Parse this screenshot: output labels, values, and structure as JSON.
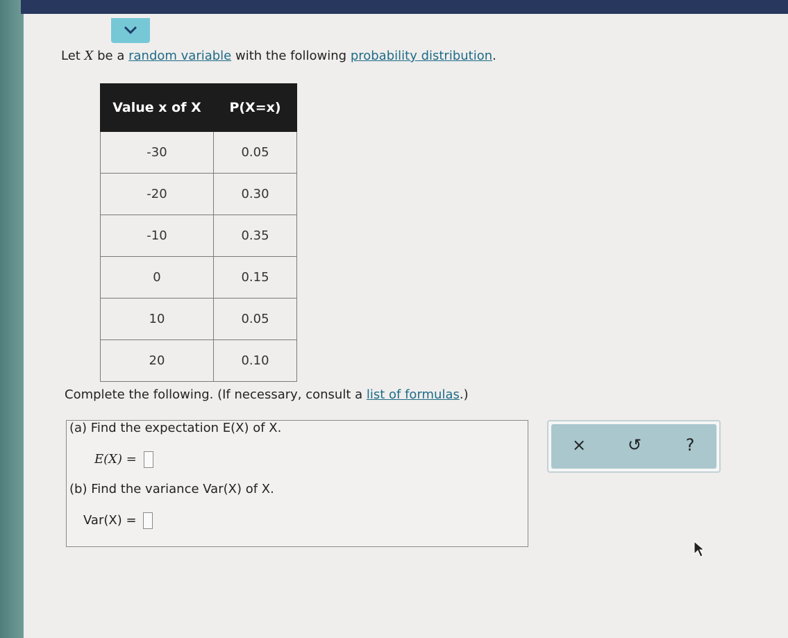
{
  "intro": {
    "prefix": "Let ",
    "var": "X",
    "middle": " be a ",
    "link1": "random variable",
    "middle2": " with the following ",
    "link2": "probability distribution",
    "suffix": "."
  },
  "table": {
    "header_value": "Value x of X",
    "header_prob": "P(X=x)",
    "rows": [
      {
        "x": "-30",
        "p": "0.05"
      },
      {
        "x": "-20",
        "p": "0.30"
      },
      {
        "x": "-10",
        "p": "0.35"
      },
      {
        "x": "0",
        "p": "0.15"
      },
      {
        "x": "10",
        "p": "0.05"
      },
      {
        "x": "20",
        "p": "0.10"
      }
    ]
  },
  "complete": {
    "prefix": "Complete the following. (If necessary, consult a ",
    "link": "list of formulas",
    "suffix": ".)"
  },
  "questions": {
    "a_label": "(a) Find the expectation E(X) of X.",
    "a_answer_label": "E(X) =",
    "b_label": "(b) Find the variance Var(X) of X.",
    "b_answer_label": "Var(X) ="
  },
  "toolbar": {
    "clear": "×",
    "undo": "↺",
    "help": "?"
  },
  "icons": {
    "collapse": "chevron-down-icon",
    "clear": "close-icon",
    "undo": "undo-icon",
    "help": "help-icon",
    "cursor": "mouse-pointer-icon"
  },
  "colors": {
    "accent": "#77c8d6",
    "link": "#1f6b86",
    "header_bg": "#1c1c1c",
    "toolbar": "#a9c7cd"
  }
}
